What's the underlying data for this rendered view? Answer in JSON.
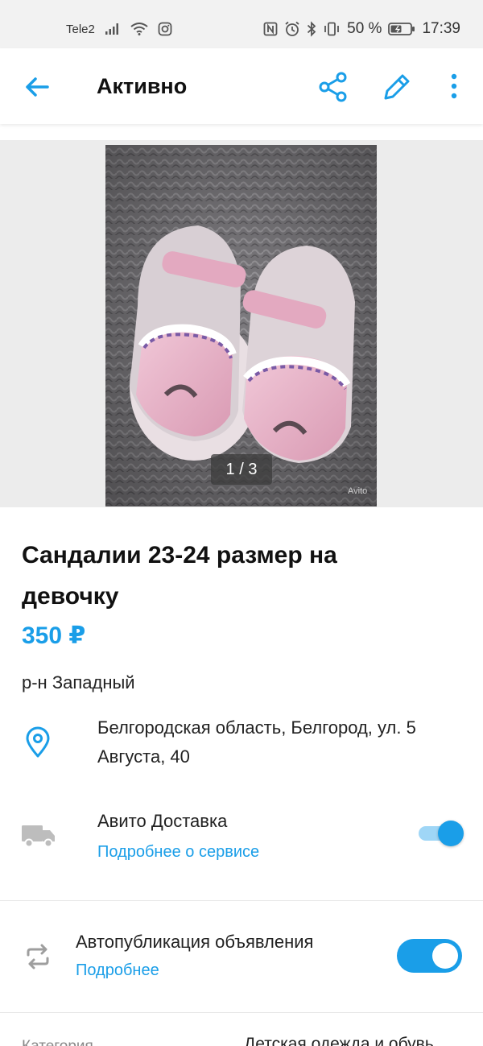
{
  "status_bar": {
    "carrier": "Tele2",
    "battery": "50 %",
    "time": "17:39"
  },
  "app_bar": {
    "title": "Активно",
    "icons": [
      "back-arrow-icon",
      "share-icon",
      "edit-pencil-icon",
      "more-vertical-icon"
    ]
  },
  "gallery": {
    "counter": "1 / 3",
    "watermark": "Avito"
  },
  "listing": {
    "title": "Сандалии 23-24 размер на девочку",
    "price": "350 ₽",
    "district": "р-н Западный",
    "address": "Белгородская область, Белгород, ул. 5 Августа, 40"
  },
  "delivery": {
    "title": "Авито Доставка",
    "link": "Подробнее о сервисе",
    "enabled": true
  },
  "autopublish": {
    "title": "Автопубликация объявления",
    "link": "Подробнее",
    "enabled": true
  },
  "category": {
    "label": "Категория",
    "value": "Детская одежда и обувь"
  },
  "colors": {
    "accent": "#1a9ee8",
    "status_bar_bg": "#f2f2f2",
    "gallery_bg": "#ececec"
  }
}
